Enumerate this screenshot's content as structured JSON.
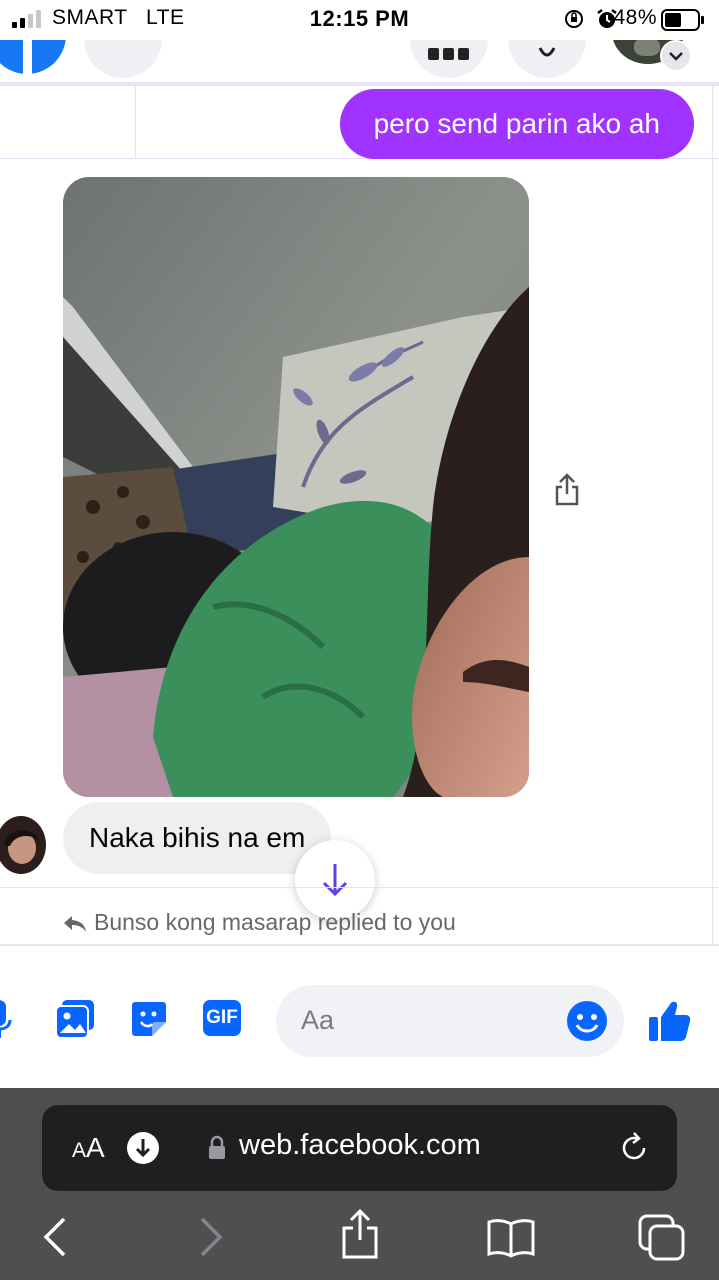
{
  "status_bar": {
    "carrier": "SMART",
    "network": "LTE",
    "time": "12:15 PM",
    "battery_percent": "48%"
  },
  "conversation": {
    "outgoing_message": "pero send parin ako ah",
    "incoming_message": "Naka bihis na em",
    "reply_notice": "Bunso kong masarap replied to you"
  },
  "composer": {
    "placeholder": "Aa",
    "gif_label": "GIF",
    "icons": [
      "microphone-icon",
      "photo-icon",
      "sticker-icon",
      "gif-icon",
      "emoji-icon",
      "like-icon"
    ],
    "accent_color": "#0866ff"
  },
  "browser": {
    "text_size_label_small": "A",
    "text_size_label_large": "A",
    "url": "web.facebook.com",
    "toolbar_icons": [
      "back-icon",
      "forward-icon",
      "share-icon",
      "bookmarks-icon",
      "tabs-icon"
    ]
  },
  "colors": {
    "outgoing_bubble": "#a033ff",
    "incoming_bubble": "#efeff1",
    "safari_bar": "#4f4f51"
  }
}
